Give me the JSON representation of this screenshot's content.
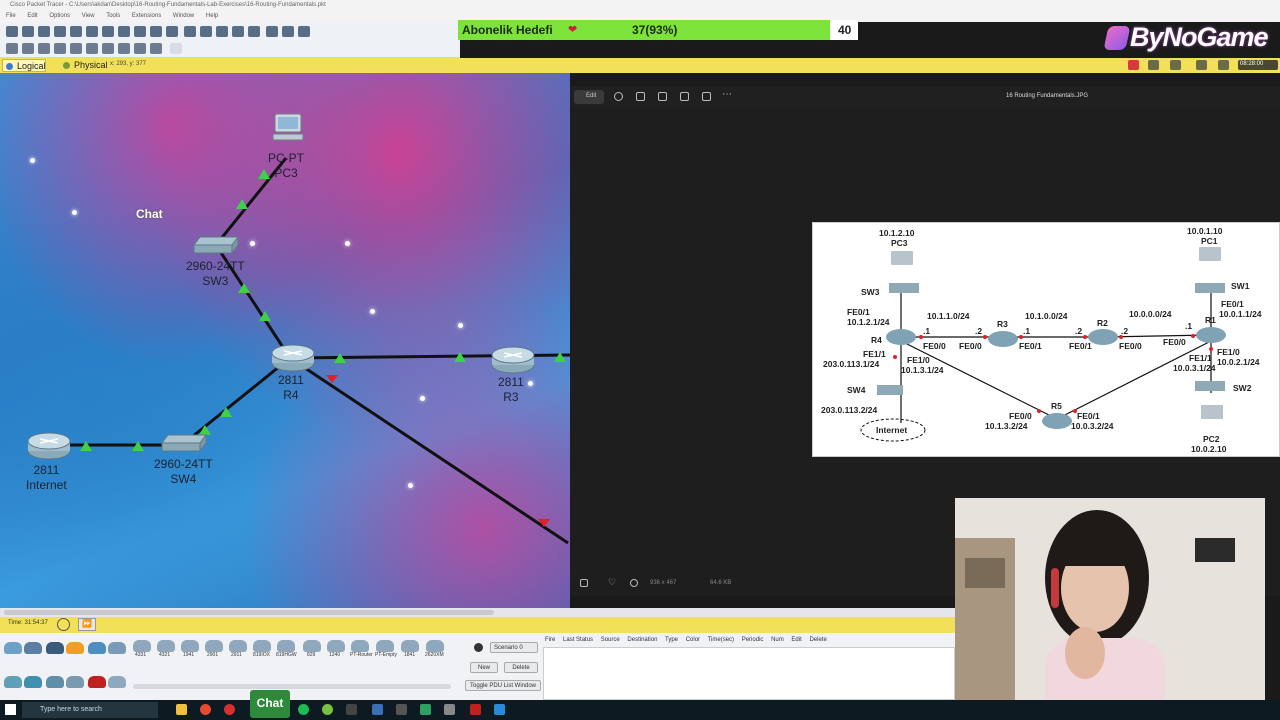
{
  "window": {
    "title": "Cisco Packet Tracer - C:\\Users\\akdan\\Desktop\\16-Routing-Fundamentals-Lab-Exercises\\16-Routing-Fundamentals.pkt",
    "menus": [
      "File",
      "Edit",
      "Options",
      "View",
      "Tools",
      "Extensions",
      "Window",
      "Help"
    ]
  },
  "subscription": {
    "title": "Abonelik Hedefi",
    "heart_icon": "heart-icon",
    "value": "37(93%)",
    "progress_fraction": 0.93,
    "goal": "40"
  },
  "brand": {
    "name": "ByNoGame"
  },
  "viewbar": {
    "logical_tab": "Logical",
    "physical_tab": "Physical",
    "coords": "x: 293, y: 377",
    "clock": "08:28:00"
  },
  "workspace": {
    "chat_label": "Chat",
    "devices": [
      {
        "id": "pc3",
        "line1": "PC-PT",
        "line2": "PC3"
      },
      {
        "id": "sw3",
        "line1": "2960-24TT",
        "line2": "SW3"
      },
      {
        "id": "r4",
        "line1": "2811",
        "line2": "R4"
      },
      {
        "id": "r3",
        "line1": "2811",
        "line2": "R3"
      },
      {
        "id": "internet",
        "line1": "2811",
        "line2": "Internet"
      },
      {
        "id": "sw4",
        "line1": "2960-24TT",
        "line2": "SW4"
      }
    ]
  },
  "viewer": {
    "edit_label": "Edit",
    "file_name": "16 Routing Fundamentals.JPG",
    "dimensions": "936 x 467",
    "size": "64.6 KB",
    "diagram_labels": {
      "pc3_ip": "10.1.2.10",
      "pc3": "PC3",
      "sw3": "SW3",
      "r4_fe01": "FE0/1",
      "r4_fe01_ip": "10.1.2.1/24",
      "r4": "R4",
      "r4_fe11": "FE1/1",
      "r4_fe11_ip": "203.0.113.1/24",
      "sw4": "SW4",
      "internet_ip": "203.0.113.2/24",
      "internet": "Internet",
      "net_r4_r3": "10.1.1.0/24",
      "dot1_a": ".1",
      "dot2_a": ".2",
      "r4_fe00": "FE0/0",
      "r3": "R3",
      "r3_fe00": "FE0/0",
      "dot1_b": ".1",
      "net_r3_r2": "10.1.0.0/24",
      "r3_fe01": "FE0/1",
      "dot2_b": ".2",
      "r2": "R2",
      "r2_fe01": "FE0/1",
      "dot2_c": ".2",
      "net_r2_r1": "10.0.0.0/24",
      "r2_fe00": "FE0/0",
      "dot1_c": ".1",
      "r1_fe00": "FE0/0",
      "r1": "R1",
      "pc1_ip": "10.0.1.10",
      "pc1": "PC1",
      "sw1": "SW1",
      "r1_fe01": "FE0/1",
      "r1_fe01_ip": "10.0.1.1/24",
      "r1_fe10": "FE1/0",
      "r1_fe10_ip": "10.0.2.1/24",
      "r1_fe11": "FE1/1",
      "r1_fe11_ip": "10.0.3.1/24",
      "sw2": "SW2",
      "pc2": "PC2",
      "pc2_ip": "10.0.2.10",
      "r4_fe10": "FE1/0",
      "r4_fe10_ip": "10.1.3.1/24",
      "r5": "R5",
      "r5_fe00": "FE0/0",
      "r5_fe00_ip": "10.1.3.2/24",
      "r5_fe01": "FE0/1",
      "r5_fe01_ip": "10.0.3.2/24"
    }
  },
  "bottom": {
    "time": "Time: 31:54:37",
    "scenario": "Scenario 0",
    "new_btn": "New",
    "delete_btn": "Delete",
    "toggle_btn": "Toggle PDU List Window",
    "pdu_columns": [
      "Fire",
      "Last Status",
      "Source",
      "Destination",
      "Type",
      "Color",
      "Time(sec)",
      "Periodic",
      "Num",
      "Edit",
      "Delete"
    ],
    "device_models": [
      "4331",
      "4321",
      "1941",
      "2901",
      "2911",
      "819IOX",
      "819HGW",
      "829",
      "1240",
      "PT-Router",
      "PT-Empty",
      "1841",
      "2620XM"
    ]
  },
  "taskbar": {
    "search_placeholder": "Type here to search",
    "chat_overlay": "Chat"
  }
}
